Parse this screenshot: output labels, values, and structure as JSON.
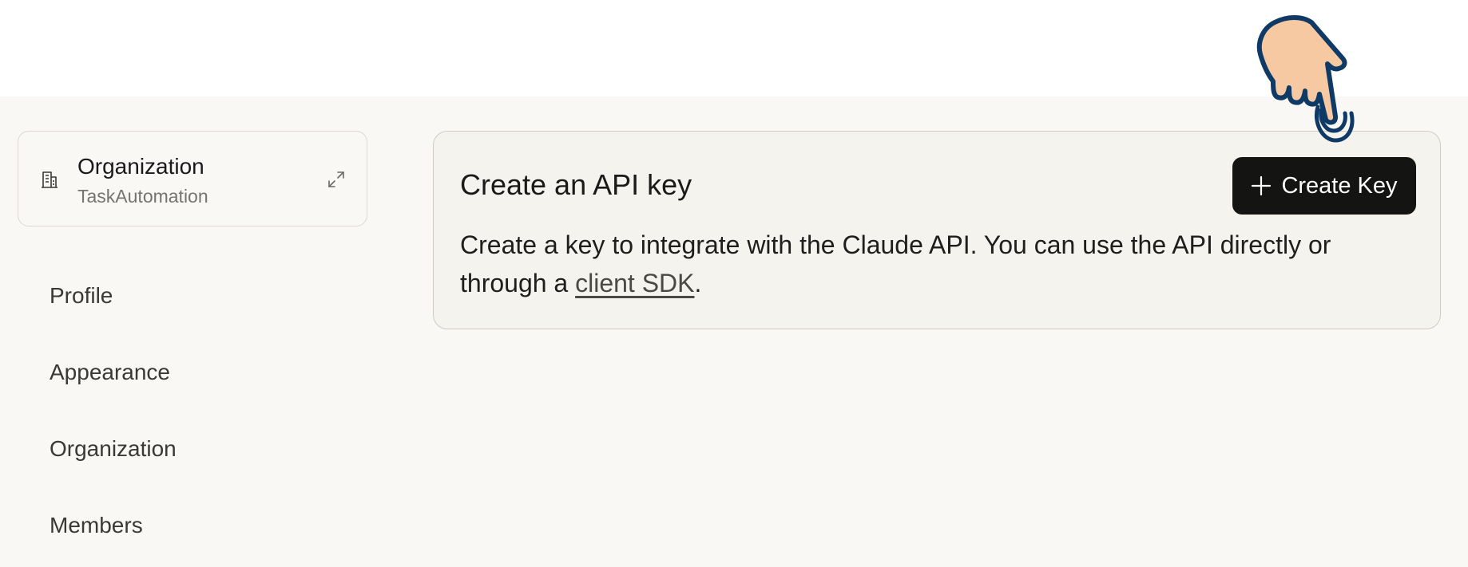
{
  "sidebar": {
    "org_switcher": {
      "title": "Organization",
      "subtitle": "TaskAutomation",
      "icon": "building-icon",
      "expand_icon": "expand-icon"
    },
    "nav_items": [
      {
        "label": "Profile"
      },
      {
        "label": "Appearance"
      },
      {
        "label": "Organization"
      },
      {
        "label": "Members"
      }
    ]
  },
  "main": {
    "card": {
      "title": "Create an API key",
      "description_before": "Create a key to integrate with the Claude API. You can use the API directly or through a ",
      "link_text": "client SDK",
      "description_after": ".",
      "button_label": "Create Key",
      "button_icon": "plus-icon"
    }
  },
  "overlay": {
    "cursor_icon": "hand-pointer-icon"
  },
  "colors": {
    "background": "#f9f8f5",
    "topbar": "#ffffff",
    "card_background": "#f4f3ee",
    "button_background": "#141413",
    "button_text": "#ffffff",
    "muted_text": "#76746e",
    "cursor_skin": "#f6c9a3",
    "cursor_outline": "#0f3a66"
  }
}
